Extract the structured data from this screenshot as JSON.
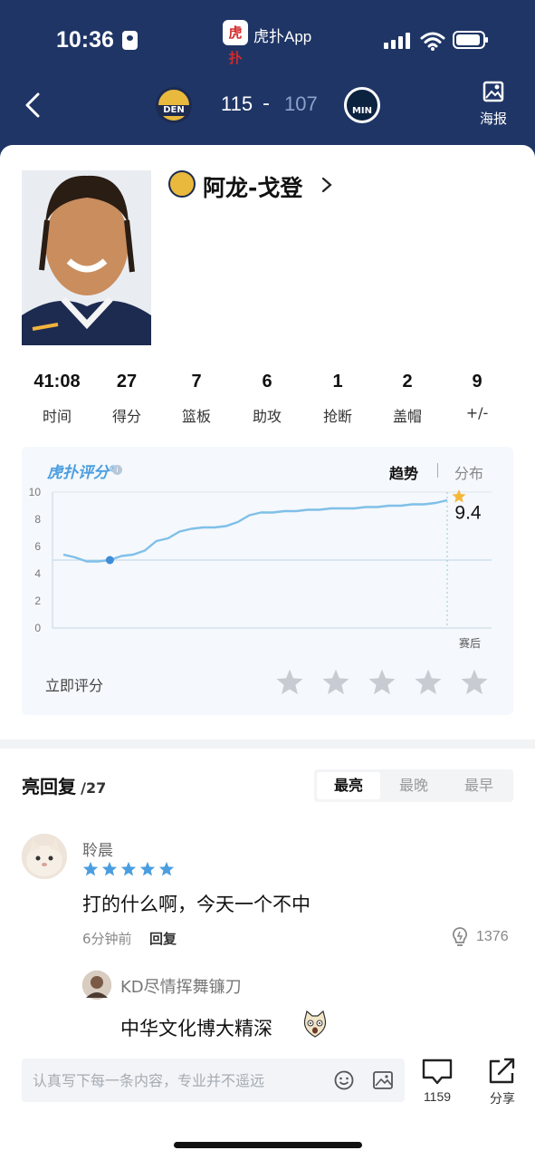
{
  "status_bar": {
    "time": "10:36",
    "app_name": "虎扑App",
    "app_logo": "虎扑"
  },
  "game": {
    "home_team": "DEN",
    "away_team": "MIN",
    "home_score": "115",
    "score_separator": "-",
    "away_score": "107",
    "poster_label": "海报"
  },
  "player": {
    "team": "DEN",
    "name": "阿龙-戈登",
    "stats": [
      {
        "value": "41:08",
        "label": "时间"
      },
      {
        "value": "27",
        "label": "得分"
      },
      {
        "value": "7",
        "label": "篮板"
      },
      {
        "value": "6",
        "label": "助攻"
      },
      {
        "value": "1",
        "label": "抢断"
      },
      {
        "value": "2",
        "label": "盖帽"
      },
      {
        "value": "9",
        "label": "+/-"
      }
    ]
  },
  "rating": {
    "logo_text": "虎扑评分",
    "logo_mark": "®",
    "tab_trend": "趋势",
    "tab_distribution": "分布",
    "rate_label": "立即评分",
    "star_count": 5
  },
  "chart_data": {
    "type": "line",
    "x_end_label": "赛后",
    "ylim": [
      0,
      10
    ],
    "y_ticks": [
      "0",
      "2",
      "4",
      "6",
      "8",
      "10"
    ],
    "reference_line": 5,
    "final_value": "9.4",
    "series": [
      {
        "values": [
          5.4,
          5.2,
          4.9,
          4.9,
          5.0,
          5.3,
          5.4,
          5.7,
          6.4,
          6.6,
          7.1,
          7.3,
          7.4,
          7.4,
          7.5,
          7.8,
          8.3,
          8.5,
          8.5,
          8.6,
          8.6,
          8.7,
          8.7,
          8.8,
          8.8,
          8.8,
          8.9,
          8.9,
          9.0,
          9.0,
          9.1,
          9.1,
          9.2,
          9.4
        ],
        "marker_index": 4
      }
    ],
    "colors": {
      "line": "#7fc0e8",
      "marker": "#3d8ed6",
      "star": "#f4b73a",
      "reference": "#c6dcec"
    }
  },
  "comments": {
    "title": "亮回复",
    "count": "/27",
    "sort_tabs": [
      "最亮",
      "最晚",
      "最早"
    ],
    "active_sort": 0,
    "items": [
      {
        "user": "聆晨",
        "stars": 5,
        "text": "打的什么啊，今天一个不中",
        "time": "6分钟前",
        "reply_label": "回复",
        "likes": "1376",
        "reply": {
          "user": "KD尽情挥舞镰刀",
          "text": "中华文化博大精深"
        }
      }
    ]
  },
  "bottom_bar": {
    "input_placeholder": "认真写下每一条内容，专业并不遥远",
    "comment_count": "1159",
    "share_label": "分享"
  },
  "colors": {
    "header_bg": "#1f3566",
    "accent_blue": "#4a9ee0",
    "star_gray": "#c8ccd2"
  }
}
